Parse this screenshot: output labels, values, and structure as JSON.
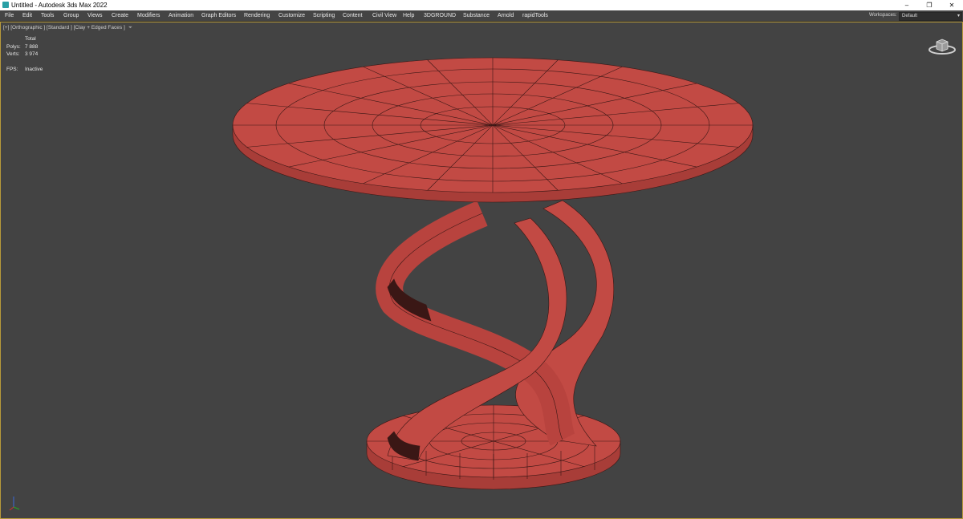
{
  "window": {
    "title": "Untitled - Autodesk 3ds Max 2022",
    "minimize": "–",
    "restore": "❐",
    "close": "✕"
  },
  "menu": {
    "items": [
      "File",
      "Edit",
      "Tools",
      "Group",
      "Views",
      "Create",
      "Modifiers",
      "Animation",
      "Graph Editors",
      "Rendering",
      "Customize",
      "Scripting",
      "Content",
      "Civil View",
      "Help",
      "3DGROUND",
      "Substance",
      "Arnold",
      "rapidTools"
    ]
  },
  "workspaces": {
    "label": "Workspaces:",
    "value": "Default"
  },
  "viewport": {
    "label": "[+] [Orthographic ] [Standard ] [Clay + Edged Faces ]",
    "stats": {
      "header": "Total",
      "polys_label": "Polys:",
      "polys_value": "7 888",
      "verts_label": "Verts:",
      "verts_value": "3 974",
      "fps_label": "FPS:",
      "fps_value": "Inactive"
    }
  },
  "icons": [
    "app-icon",
    "filter-icon",
    "viewcube-icon",
    "axis-tripod-icon"
  ],
  "colors": {
    "model": "#c24a44",
    "edges": "#3a1715",
    "viewport_bg": "#434343",
    "active_border": "#b79a3a"
  }
}
